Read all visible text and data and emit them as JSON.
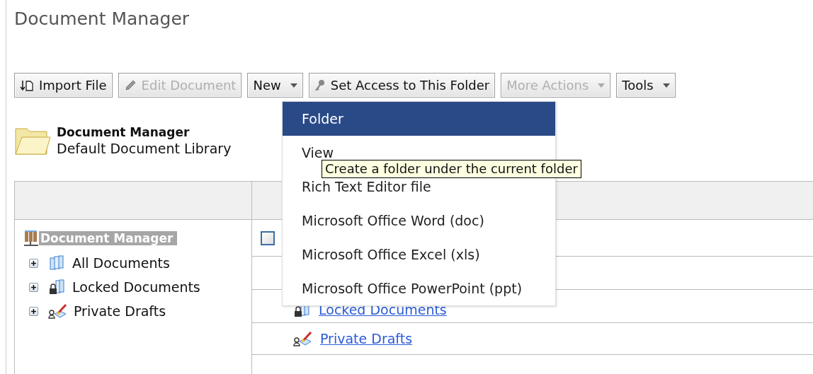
{
  "window": {
    "title": "Document Manager"
  },
  "toolbar": [
    {
      "label": "Import File",
      "kind": "import",
      "disabled": false
    },
    {
      "label": "Edit Document",
      "kind": "edit",
      "disabled": true
    },
    {
      "label": "New",
      "kind": "dropdown",
      "disabled": false
    },
    {
      "label": "Set Access to This Folder",
      "kind": "access",
      "disabled": false
    },
    {
      "label": "More Actions",
      "kind": "dropdown",
      "disabled": true
    },
    {
      "label": "Tools",
      "kind": "dropdown",
      "disabled": false
    }
  ],
  "library": {
    "name": "Document Manager",
    "description": "Default Document Library"
  },
  "tree": {
    "label": "Document Manager",
    "selected": true,
    "children": [
      {
        "label": "All Documents",
        "kind": "all",
        "expanded": false
      },
      {
        "label": "Locked Documents",
        "kind": "locked",
        "expanded": false
      },
      {
        "label": "Private Drafts",
        "kind": "drafts",
        "expanded": false
      }
    ]
  },
  "list": {
    "rows": [
      {
        "kind": "checkbox",
        "checked": false
      },
      {
        "kind": "locked",
        "label": "Locked Documents"
      },
      {
        "kind": "drafts",
        "label": "Private Drafts"
      }
    ]
  },
  "menu": {
    "items": [
      {
        "label": "Folder",
        "selected": true
      },
      {
        "label": "View",
        "selected": false
      },
      {
        "label": "Rich Text Editor file",
        "selected": false
      },
      {
        "label": "Microsoft Office Word (doc)",
        "selected": false
      },
      {
        "label": "Microsoft Office Excel (xls)",
        "selected": false
      },
      {
        "label": "Microsoft Office PowerPoint (ppt)",
        "selected": false
      }
    ]
  },
  "tooltip": {
    "text": "Create a folder under the current folder"
  }
}
